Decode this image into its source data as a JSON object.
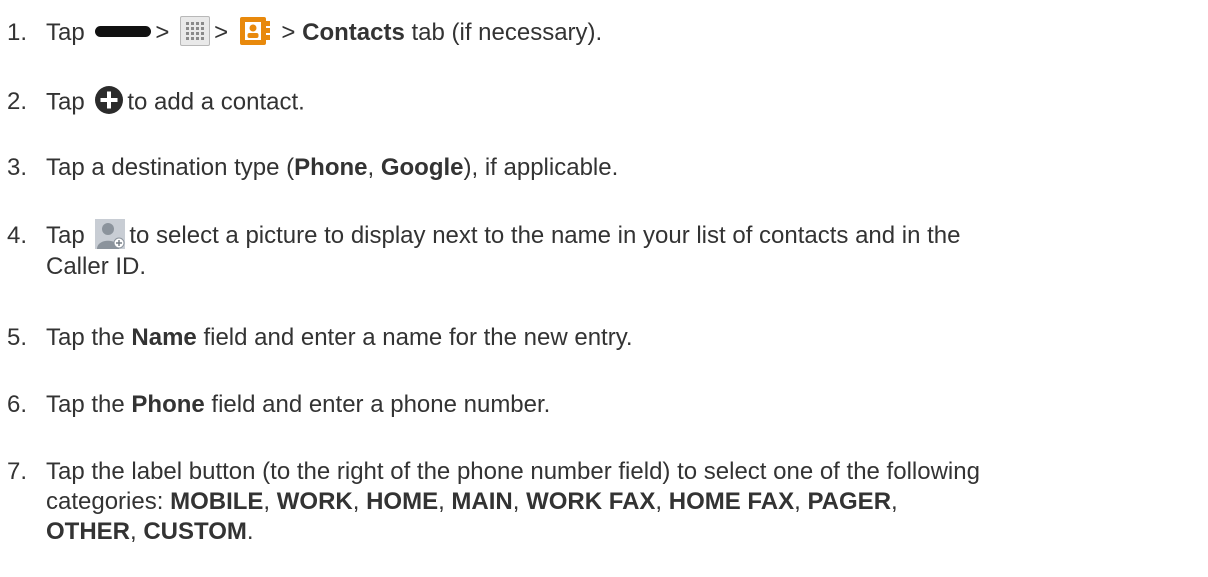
{
  "steps": [
    {
      "number": "1.",
      "parts": {
        "t1": "Tap",
        "t2": ">",
        "t3": ">",
        "t4": ">",
        "b1": "Contacts",
        "t5": "tab (if necessary)."
      },
      "icons": [
        "home-key-icon",
        "apps-icon",
        "contacts-app-icon"
      ]
    },
    {
      "number": "2.",
      "parts": {
        "t1": "Tap",
        "t2": "to add a contact."
      },
      "icons": [
        "add-contact-icon"
      ]
    },
    {
      "number": "3.",
      "parts": {
        "t1": "Tap a destination type (",
        "b1": "Phone",
        "t2": ", ",
        "b2": "Google",
        "t3": "), if applicable."
      }
    },
    {
      "number": "4.",
      "parts": {
        "t1": "Tap",
        "t2": "to select a picture to display next to the name in your list of contacts and in the",
        "t3": "Caller ID."
      },
      "icons": [
        "contact-picture-icon"
      ]
    },
    {
      "number": "5.",
      "parts": {
        "t1": "Tap the",
        "b1": "Name",
        "t2": "field and enter a name for the new entry."
      }
    },
    {
      "number": "6.",
      "parts": {
        "t1": "Tap the",
        "b1": "Phone",
        "t2": "field and enter a phone number."
      }
    },
    {
      "number": "7.",
      "parts": {
        "t1": "Tap the label button (to the right of the phone number field) to select one of the following",
        "t2": "categories: ",
        "b1": "MOBILE",
        "c1": ", ",
        "b2": "WORK",
        "c2": ", ",
        "b3": "HOME",
        "c3": ", ",
        "b4": "MAIN",
        "c4": ", ",
        "b5": "WORK FAX",
        "c5": ", ",
        "b6": "HOME FAX",
        "c6": ", ",
        "b7": "PAGER",
        "c7": ",",
        "b8": "OTHER",
        "c8": ", ",
        "b9": "CUSTOM",
        "c9": "."
      }
    }
  ],
  "colors": {
    "text": "#333333",
    "contacts_icon": "#e8890c",
    "add_icon": "#2b2b2b"
  }
}
